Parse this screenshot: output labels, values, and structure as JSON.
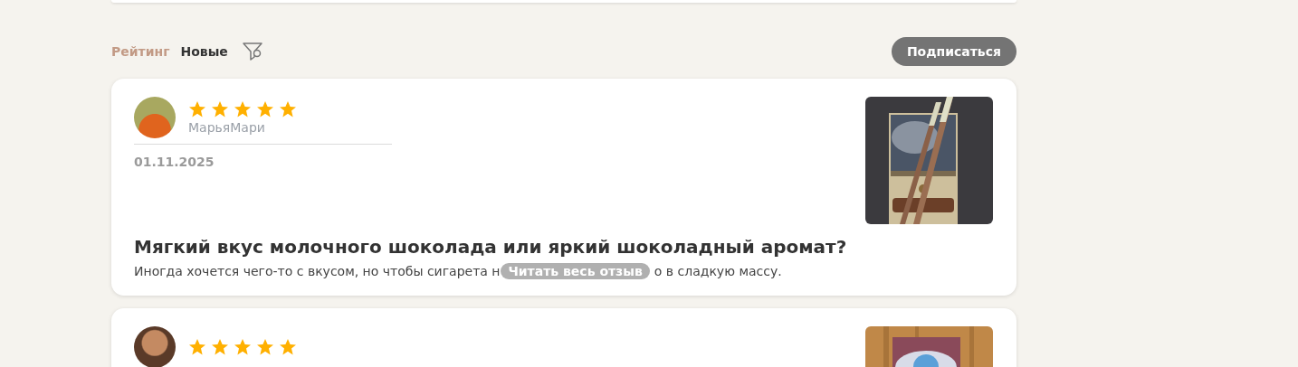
{
  "sort_tabs": [
    {
      "label": "Рейтинг",
      "selected": true
    },
    {
      "label": "Новые",
      "selected": false
    }
  ],
  "subscribe_button": "Подписаться",
  "reviews": [
    {
      "stars": 5,
      "author": "МарьяМари",
      "date": "01.11.2025",
      "photo": true,
      "title": "Мягкий вкус молочного шоколада или яркий шоколадный аромат?",
      "text_before": "Иногда хочется чего-то с вкусом, но чтобы сигарета н",
      "read_more": "Читать весь отзыв",
      "text_after": "о в сладкую массу."
    },
    {
      "stars": 5,
      "photo": true
    }
  ]
}
